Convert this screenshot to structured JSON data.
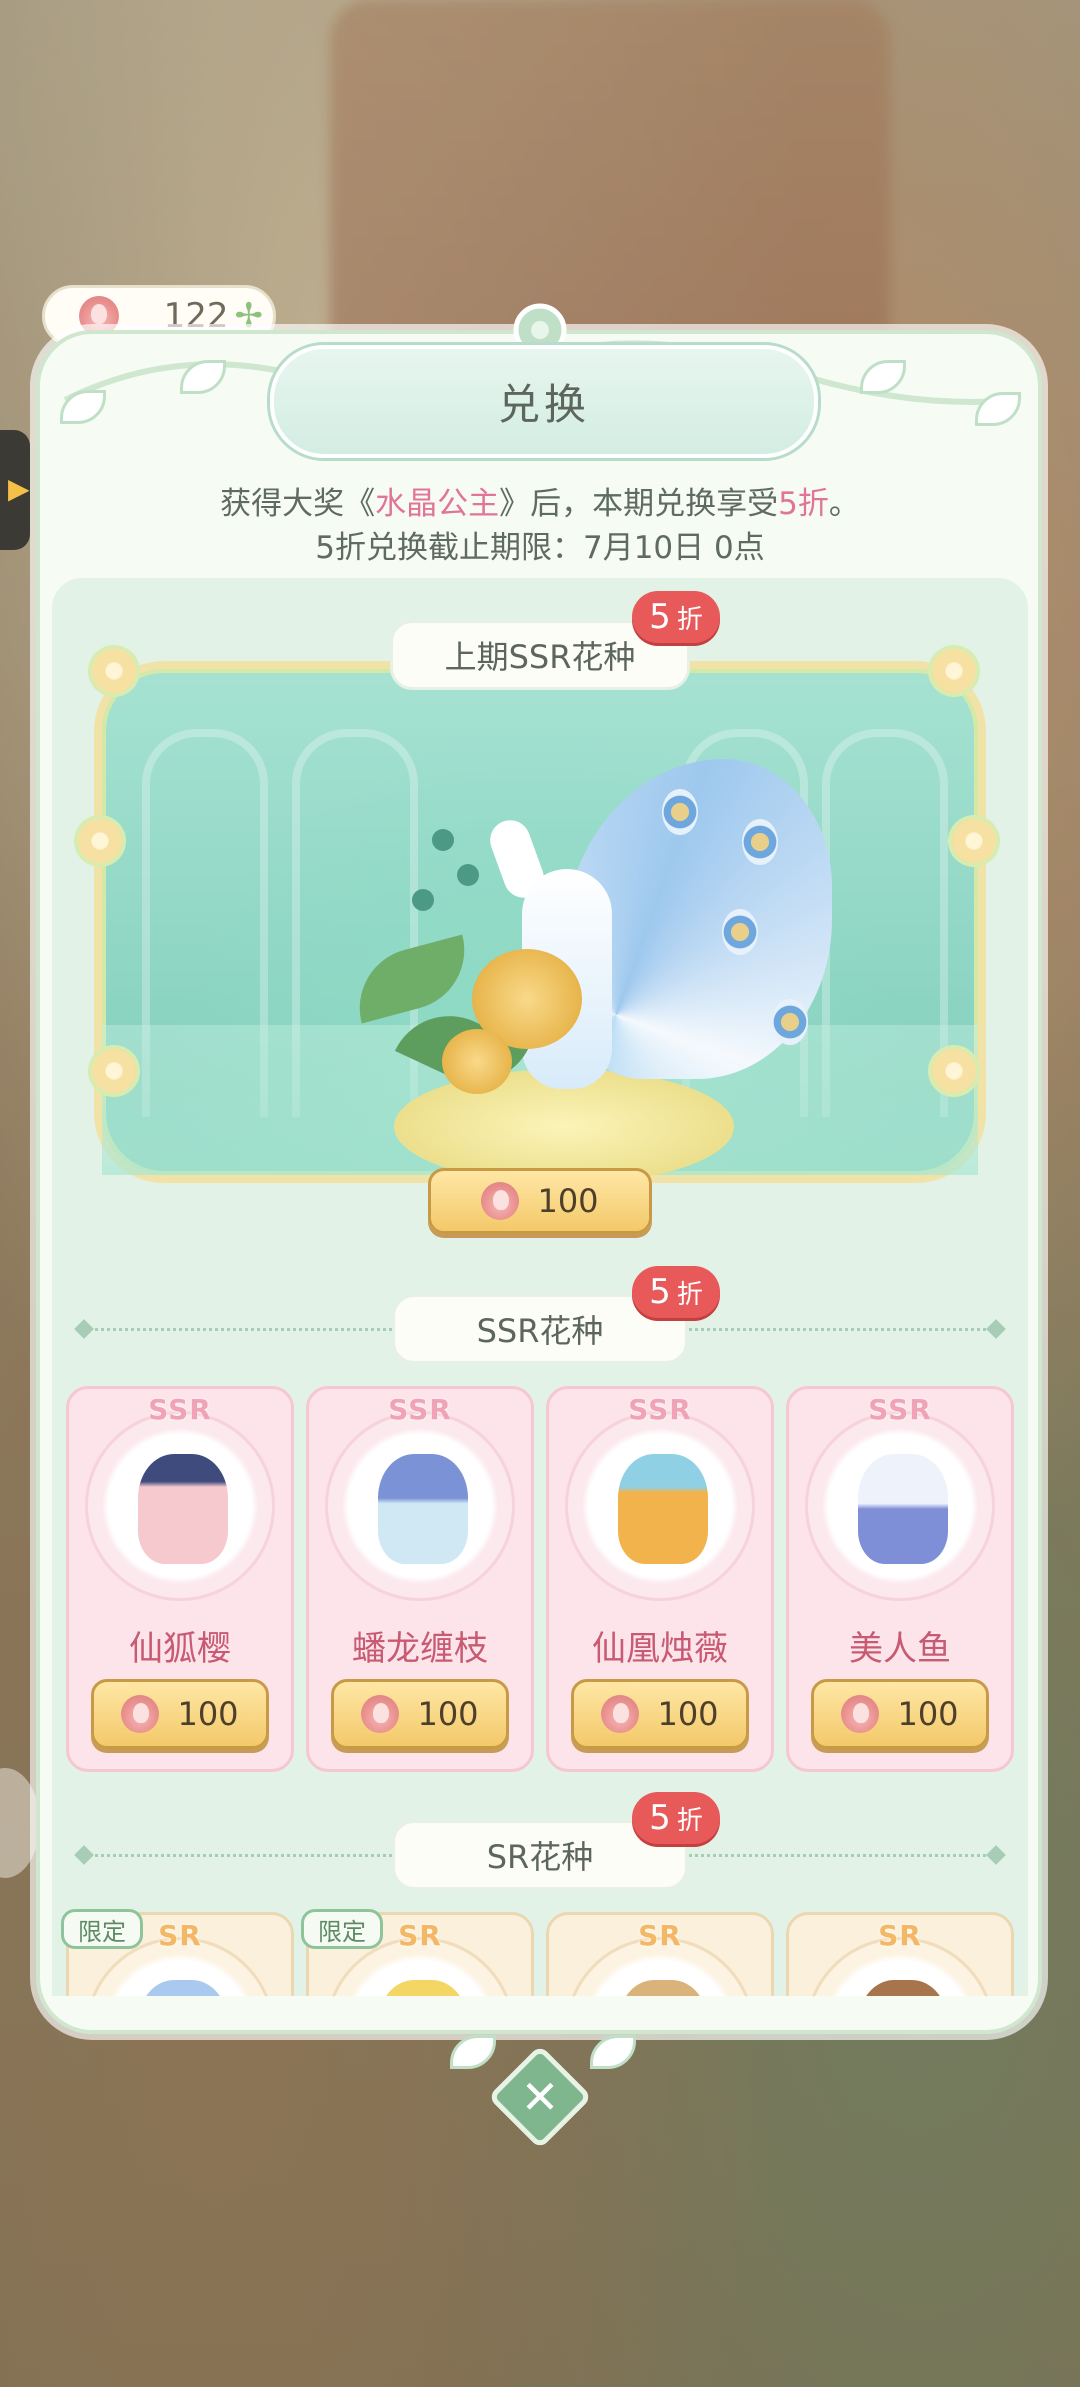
{
  "currency": {
    "icon": "flower-icon",
    "count": "122",
    "plus_icon": "plus-icon"
  },
  "panel": {
    "title": "兑换"
  },
  "notice": {
    "line1_before": "获得大奖《",
    "line1_highlight": "水晶公主",
    "line1_middle": "》后，本期兑换享受",
    "line1_discount": "5折",
    "line1_after": "。",
    "line2": "5折兑换截止期限：7月10日 0点"
  },
  "featured": {
    "section_label": "上期SSR花种",
    "badge_num": "5",
    "badge_unit": "折",
    "price": "100"
  },
  "ssr_section": {
    "label": "SSR花种",
    "badge_num": "5",
    "badge_unit": "折",
    "items": [
      {
        "rarity": "SSR",
        "name": "仙狐樱",
        "price": "100"
      },
      {
        "rarity": "SSR",
        "name": "蟠龙缠枝",
        "price": "100"
      },
      {
        "rarity": "SSR",
        "name": "仙凰烛薇",
        "price": "100"
      },
      {
        "rarity": "SSR",
        "name": "美人鱼",
        "price": "100"
      }
    ]
  },
  "sr_section": {
    "label": "SR花种",
    "badge_num": "5",
    "badge_unit": "折",
    "items": [
      {
        "rarity": "SR",
        "tag": "限定"
      },
      {
        "rarity": "SR",
        "tag": "限定"
      },
      {
        "rarity": "SR",
        "tag": ""
      },
      {
        "rarity": "SR",
        "tag": ""
      }
    ]
  },
  "colors": {
    "accent_pink": "#e07599",
    "badge_red": "#e8595a",
    "mint": "#7fcdba",
    "gold": "#f3c96a"
  },
  "close_button": {
    "icon": "close-icon",
    "glyph": "✕"
  },
  "side_tab": {
    "icon": "chevron-right-icon",
    "glyph": "▶"
  }
}
